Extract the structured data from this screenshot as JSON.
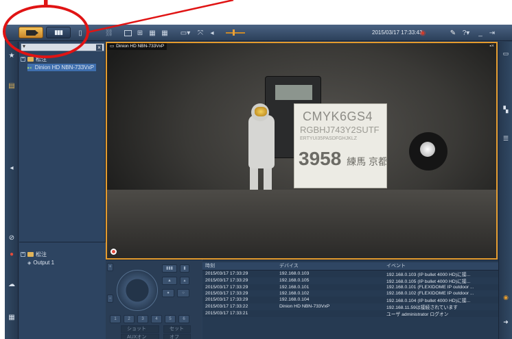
{
  "toolbar": {
    "live_tab": "camera-icon",
    "playback_tab": "playback-icon",
    "clock": "2015/03/17 17:33:43",
    "help_label": "?",
    "minimize_label": "_"
  },
  "colors": {
    "accent_orange": "#e49b2e",
    "annotation_red": "#e01414",
    "panel_bg": "#2d4461",
    "selection": "#3f6fae"
  },
  "tree": {
    "root_label": "松注",
    "camera_label": "Dinion HD NBN-733VxP"
  },
  "tree2": {
    "root_label": "松注",
    "output_label": "Output 1"
  },
  "video": {
    "title": "Dinion HD NBN-733VxP",
    "card_line1": "CMYK6GS4",
    "card_line2": "RGBHJ743Y2SUTF",
    "card_line3": "ERTYUI35PASDFGHJKLZ",
    "card_line4_num": "3958",
    "card_line4_text": "練馬 京都 品川 なにわ"
  },
  "ptz": {
    "preset_label": "ショット",
    "set_label": "セット",
    "aux_on_label": "AUXオン",
    "aux_off_label": "オフ"
  },
  "log": {
    "headers": [
      "時刻",
      "デバイス",
      "イベント"
    ],
    "rows": [
      [
        "2015/03/17 17:33:29",
        "192.168.0.103",
        "192.168.0.103 (IP bullet 4000 HD)に接..."
      ],
      [
        "2015/03/17 17:33:29",
        "192.168.0.105",
        "192.168.0.105 (IP bullet 4000 HD)に接..."
      ],
      [
        "2015/03/17 17:33:29",
        "192.168.0.101",
        "192.168.0.101 (FLEXIDOME IP outdoor ..."
      ],
      [
        "2015/03/17 17:33:29",
        "192.168.0.102",
        "192.168.0.102 (FLEXIDOME IP outdoor ..."
      ],
      [
        "2015/03/17 17:33:29",
        "192.168.0.104",
        "192.168.0.104 (IP bullet 4000 HD)に接..."
      ],
      [
        "2015/03/17 17:33:22",
        "Dinion HD NBN-733VxP",
        "192.168.11.59は接続されています"
      ],
      [
        "2015/03/17 17:33:21",
        "",
        "ユーザ administrator ログオン"
      ]
    ]
  }
}
